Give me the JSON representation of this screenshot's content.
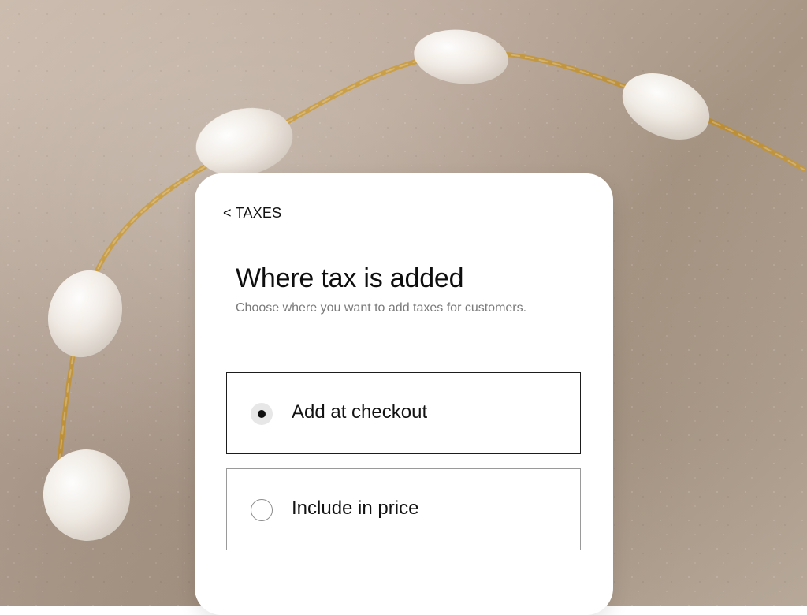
{
  "navigation": {
    "back_label": "< TAXES"
  },
  "page": {
    "title": "Where tax is added",
    "subtitle": "Choose where you want to add taxes for customers."
  },
  "options": [
    {
      "label": "Add at checkout",
      "selected": true
    },
    {
      "label": "Include in price",
      "selected": false
    }
  ],
  "colors": {
    "card_bg": "#ffffff",
    "selected_border": "#1d1d1d",
    "unselected_border": "#9a9a9a",
    "subtitle": "#7a7a7a",
    "radio_fill_selected": "#e7e7e7",
    "radio_dot": "#0f0f0f"
  },
  "background": {
    "theme_icon": "pearl-bracelet-on-sand-image"
  }
}
